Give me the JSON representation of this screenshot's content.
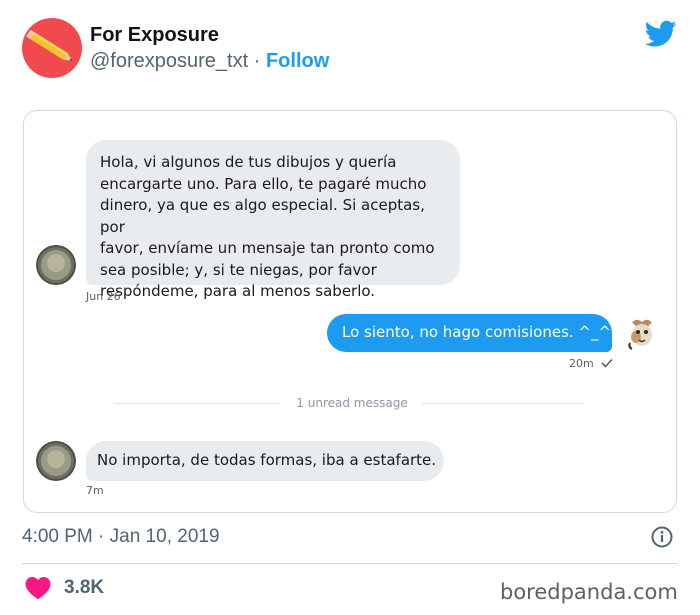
{
  "author": {
    "display_name": "For Exposure",
    "handle": "@forexposure_txt",
    "separator": "·",
    "follow_label": "Follow",
    "avatar_color": "#f04a4f",
    "avatar_icon": "pencil-icon"
  },
  "brand": {
    "icon": "twitter-bird-icon",
    "color": "#1d9bf0"
  },
  "conversation": {
    "messages": [
      {
        "direction": "incoming",
        "lines": [
          "Hola, vi algunos de tus dibujos y quería",
          "encargarte uno. Para ello, te pagaré mucho",
          "dinero, ya que es algo especial. Si aceptas, por",
          "favor, envíame un mensaje tan pronto como",
          "sea posible; y, si te niegas, por favor",
          "respóndeme, para al menos saberlo."
        ],
        "time": "Jun 26"
      },
      {
        "direction": "outgoing",
        "text": "Lo siento, no hago comisiones. ^_^",
        "time": "20m",
        "status_icon": "check-icon"
      },
      {
        "direction": "incoming",
        "text": "No importa, de todas formas, iba a estafarte.",
        "time": "7m"
      }
    ],
    "unread_divider": "1 unread message"
  },
  "footer": {
    "timestamp": "4:00 PM · Jan 10, 2019",
    "likes": "3.8K",
    "like_icon": "heart-icon",
    "info_icon": "info-icon",
    "heart_color": "#f91880"
  },
  "watermark": "boredpanda.com"
}
